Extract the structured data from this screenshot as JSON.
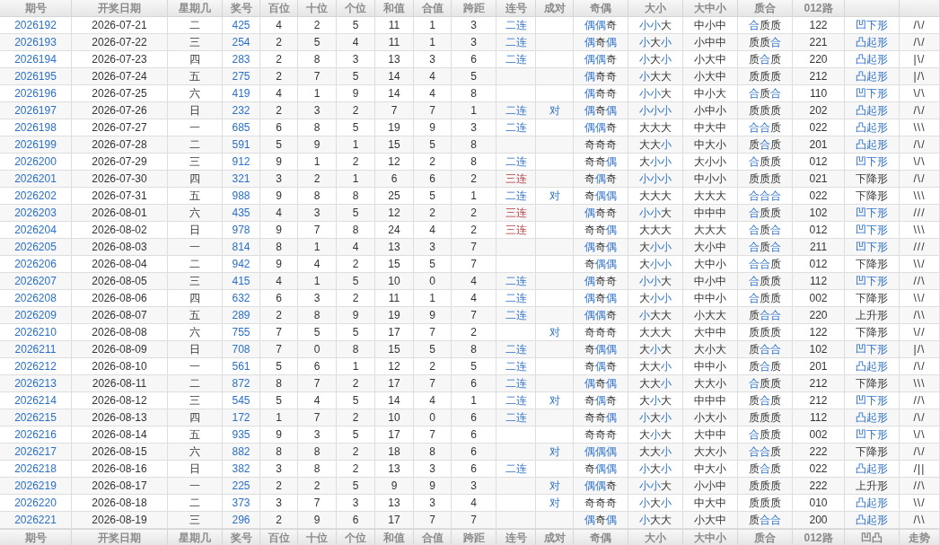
{
  "header_top": [
    "期号",
    "开奖日期",
    "星期几",
    "奖号",
    "百位",
    "十位",
    "个位",
    "和值",
    "合值",
    "跨距",
    "连号",
    "成对",
    "奇偶",
    "大小",
    "大中小",
    "质合",
    "012路"
  ],
  "rows": [
    {
      "issue": "2026192",
      "date": "2026-07-21",
      "weekday": "二",
      "number": "425",
      "hundreds": "4",
      "tens": "2",
      "units": "5",
      "sum": "11",
      "sum_tail": "1",
      "span": "3",
      "consecutive": {
        "text": "二连",
        "kind": "double"
      },
      "parity": {
        "text": "偶偶奇",
        "marked": [
          true,
          true,
          false
        ]
      },
      "size": {
        "text": "小小大",
        "marked": [
          true,
          true,
          false
        ]
      },
      "range": "中小中",
      "prime": {
        "text": "合质质",
        "marked": [
          true,
          false,
          false
        ]
      },
      "road": "122",
      "shape": {
        "text": "凹下形",
        "marked": true
      },
      "trend": "/\\/"
    },
    {
      "issue": "2026193",
      "date": "2026-07-22",
      "weekday": "三",
      "number": "254",
      "hundreds": "2",
      "tens": "5",
      "units": "4",
      "sum": "11",
      "sum_tail": "1",
      "span": "3",
      "consecutive": {
        "text": "二连",
        "kind": "double"
      },
      "parity": {
        "text": "偶奇偶",
        "marked": [
          true,
          false,
          true
        ]
      },
      "size": {
        "text": "小大小",
        "marked": [
          true,
          false,
          true
        ]
      },
      "range": "小中中",
      "prime": {
        "text": "质质合",
        "marked": [
          false,
          false,
          true
        ]
      },
      "road": "221",
      "shape": {
        "text": "凸起形",
        "marked": true
      },
      "trend": "/\\/"
    },
    {
      "issue": "2026194",
      "date": "2026-07-23",
      "weekday": "四",
      "number": "283",
      "hundreds": "2",
      "tens": "8",
      "units": "3",
      "sum": "13",
      "sum_tail": "3",
      "span": "6",
      "consecutive": {
        "text": "二连",
        "kind": "double"
      },
      "parity": {
        "text": "偶偶奇",
        "marked": [
          true,
          true,
          false
        ]
      },
      "size": {
        "text": "小大小",
        "marked": [
          true,
          false,
          true
        ]
      },
      "range": "小大中",
      "prime": {
        "text": "质合质",
        "marked": [
          false,
          true,
          false
        ]
      },
      "road": "220",
      "shape": {
        "text": "凸起形",
        "marked": true
      },
      "trend": "|\\/"
    },
    {
      "issue": "2026195",
      "date": "2026-07-24",
      "weekday": "五",
      "number": "275",
      "hundreds": "2",
      "tens": "7",
      "units": "5",
      "sum": "14",
      "sum_tail": "4",
      "span": "5",
      "parity": {
        "text": "偶奇奇",
        "marked": [
          true,
          false,
          false
        ]
      },
      "size": {
        "text": "小大大",
        "marked": [
          true,
          false,
          false
        ]
      },
      "range": "小大中",
      "prime": {
        "text": "质质质",
        "marked": [
          false,
          false,
          false
        ]
      },
      "road": "212",
      "shape": {
        "text": "凸起形",
        "marked": true
      },
      "trend": "|/\\"
    },
    {
      "issue": "2026196",
      "date": "2026-07-25",
      "weekday": "六",
      "number": "419",
      "hundreds": "4",
      "tens": "1",
      "units": "9",
      "sum": "14",
      "sum_tail": "4",
      "span": "8",
      "parity": {
        "text": "偶奇奇",
        "marked": [
          true,
          false,
          false
        ]
      },
      "size": {
        "text": "小小大",
        "marked": [
          true,
          true,
          false
        ]
      },
      "range": "中小大",
      "prime": {
        "text": "合质合",
        "marked": [
          true,
          false,
          true
        ]
      },
      "road": "110",
      "shape": {
        "text": "凹下形",
        "marked": true
      },
      "trend": "\\/\\"
    },
    {
      "issue": "2026197",
      "date": "2026-07-26",
      "weekday": "日",
      "number": "232",
      "hundreds": "2",
      "tens": "3",
      "units": "2",
      "sum": "7",
      "sum_tail": "7",
      "span": "1",
      "consecutive": {
        "text": "二连",
        "kind": "double"
      },
      "pair": "对",
      "parity": {
        "text": "偶奇偶",
        "marked": [
          true,
          false,
          true
        ]
      },
      "size": {
        "text": "小小小",
        "marked": [
          true,
          true,
          true
        ]
      },
      "range": "小中小",
      "prime": {
        "text": "质质质",
        "marked": [
          false,
          false,
          false
        ]
      },
      "road": "202",
      "shape": {
        "text": "凸起形",
        "marked": true
      },
      "trend": "/\\/"
    },
    {
      "issue": "2026198",
      "date": "2026-07-27",
      "weekday": "一",
      "number": "685",
      "hundreds": "6",
      "tens": "8",
      "units": "5",
      "sum": "19",
      "sum_tail": "9",
      "span": "3",
      "consecutive": {
        "text": "二连",
        "kind": "double"
      },
      "parity": {
        "text": "偶偶奇",
        "marked": [
          true,
          true,
          false
        ]
      },
      "size": {
        "text": "大大大",
        "marked": [
          false,
          false,
          false
        ]
      },
      "range": "中大中",
      "prime": {
        "text": "合合质",
        "marked": [
          true,
          true,
          false
        ]
      },
      "road": "022",
      "shape": {
        "text": "凸起形",
        "marked": true
      },
      "trend": "\\\\\\"
    },
    {
      "issue": "2026199",
      "date": "2026-07-28",
      "weekday": "二",
      "number": "591",
      "hundreds": "5",
      "tens": "9",
      "units": "1",
      "sum": "15",
      "sum_tail": "5",
      "span": "8",
      "parity": {
        "text": "奇奇奇",
        "marked": [
          false,
          false,
          false
        ]
      },
      "size": {
        "text": "大大小",
        "marked": [
          false,
          false,
          true
        ]
      },
      "range": "中大小",
      "prime": {
        "text": "质合质",
        "marked": [
          false,
          true,
          false
        ]
      },
      "road": "201",
      "shape": {
        "text": "凸起形",
        "marked": true
      },
      "trend": "/\\/"
    },
    {
      "issue": "2026200",
      "date": "2026-07-29",
      "weekday": "三",
      "number": "912",
      "hundreds": "9",
      "tens": "1",
      "units": "2",
      "sum": "12",
      "sum_tail": "2",
      "span": "8",
      "consecutive": {
        "text": "二连",
        "kind": "double"
      },
      "parity": {
        "text": "奇奇偶",
        "marked": [
          false,
          false,
          true
        ]
      },
      "size": {
        "text": "大小小",
        "marked": [
          false,
          true,
          true
        ]
      },
      "range": "大小小",
      "prime": {
        "text": "合质质",
        "marked": [
          true,
          false,
          false
        ]
      },
      "road": "012",
      "shape": {
        "text": "凹下形",
        "marked": true
      },
      "trend": "\\/\\"
    },
    {
      "issue": "2026201",
      "date": "2026-07-30",
      "weekday": "四",
      "number": "321",
      "hundreds": "3",
      "tens": "2",
      "units": "1",
      "sum": "6",
      "sum_tail": "6",
      "span": "2",
      "consecutive": {
        "text": "三连",
        "kind": "triple"
      },
      "parity": {
        "text": "奇偶奇",
        "marked": [
          false,
          true,
          false
        ]
      },
      "size": {
        "text": "小小小",
        "marked": [
          true,
          true,
          true
        ]
      },
      "range": "中小小",
      "prime": {
        "text": "质质质",
        "marked": [
          false,
          false,
          false
        ]
      },
      "road": "021",
      "shape": {
        "text": "下降形",
        "marked": false
      },
      "trend": "/\\/"
    },
    {
      "issue": "2026202",
      "date": "2026-07-31",
      "weekday": "五",
      "number": "988",
      "hundreds": "9",
      "tens": "8",
      "units": "8",
      "sum": "25",
      "sum_tail": "5",
      "span": "1",
      "consecutive": {
        "text": "二连",
        "kind": "double"
      },
      "pair": "对",
      "parity": {
        "text": "奇偶偶",
        "marked": [
          false,
          true,
          true
        ]
      },
      "size": {
        "text": "大大大",
        "marked": [
          false,
          false,
          false
        ]
      },
      "range": "大大大",
      "prime": {
        "text": "合合合",
        "marked": [
          true,
          true,
          true
        ]
      },
      "road": "022",
      "shape": {
        "text": "下降形",
        "marked": false
      },
      "trend": "\\\\\\"
    },
    {
      "issue": "2026203",
      "date": "2026-08-01",
      "weekday": "六",
      "number": "435",
      "hundreds": "4",
      "tens": "3",
      "units": "5",
      "sum": "12",
      "sum_tail": "2",
      "span": "2",
      "consecutive": {
        "text": "三连",
        "kind": "triple"
      },
      "parity": {
        "text": "偶奇奇",
        "marked": [
          true,
          false,
          false
        ]
      },
      "size": {
        "text": "小小大",
        "marked": [
          true,
          true,
          false
        ]
      },
      "range": "中中中",
      "prime": {
        "text": "合质质",
        "marked": [
          true,
          false,
          false
        ]
      },
      "road": "102",
      "shape": {
        "text": "凹下形",
        "marked": true
      },
      "trend": "///"
    },
    {
      "issue": "2026204",
      "date": "2026-08-02",
      "weekday": "日",
      "number": "978",
      "hundreds": "9",
      "tens": "7",
      "units": "8",
      "sum": "24",
      "sum_tail": "4",
      "span": "2",
      "consecutive": {
        "text": "三连",
        "kind": "triple"
      },
      "parity": {
        "text": "奇奇偶",
        "marked": [
          false,
          false,
          true
        ]
      },
      "size": {
        "text": "大大大",
        "marked": [
          false,
          false,
          false
        ]
      },
      "range": "大大大",
      "prime": {
        "text": "合质合",
        "marked": [
          true,
          false,
          true
        ]
      },
      "road": "012",
      "shape": {
        "text": "凹下形",
        "marked": true
      },
      "trend": "\\\\\\"
    },
    {
      "issue": "2026205",
      "date": "2026-08-03",
      "weekday": "一",
      "number": "814",
      "hundreds": "8",
      "tens": "1",
      "units": "4",
      "sum": "13",
      "sum_tail": "3",
      "span": "7",
      "parity": {
        "text": "偶奇偶",
        "marked": [
          true,
          false,
          true
        ]
      },
      "size": {
        "text": "大小小",
        "marked": [
          false,
          true,
          true
        ]
      },
      "range": "大小中",
      "prime": {
        "text": "合质合",
        "marked": [
          true,
          false,
          true
        ]
      },
      "road": "211",
      "shape": {
        "text": "凹下形",
        "marked": true
      },
      "trend": "///"
    },
    {
      "issue": "2026206",
      "date": "2026-08-04",
      "weekday": "二",
      "number": "942",
      "hundreds": "9",
      "tens": "4",
      "units": "2",
      "sum": "15",
      "sum_tail": "5",
      "span": "7",
      "parity": {
        "text": "奇偶偶",
        "marked": [
          false,
          true,
          true
        ]
      },
      "size": {
        "text": "大小小",
        "marked": [
          false,
          true,
          true
        ]
      },
      "range": "大中小",
      "prime": {
        "text": "合合质",
        "marked": [
          true,
          true,
          false
        ]
      },
      "road": "012",
      "shape": {
        "text": "下降形",
        "marked": false
      },
      "trend": "\\\\/"
    },
    {
      "issue": "2026207",
      "date": "2026-08-05",
      "weekday": "三",
      "number": "415",
      "hundreds": "4",
      "tens": "1",
      "units": "5",
      "sum": "10",
      "sum_tail": "0",
      "span": "4",
      "consecutive": {
        "text": "二连",
        "kind": "double"
      },
      "parity": {
        "text": "偶奇奇",
        "marked": [
          true,
          false,
          false
        ]
      },
      "size": {
        "text": "小小大",
        "marked": [
          true,
          true,
          false
        ]
      },
      "range": "中小中",
      "prime": {
        "text": "合质质",
        "marked": [
          true,
          false,
          false
        ]
      },
      "road": "112",
      "shape": {
        "text": "凹下形",
        "marked": true
      },
      "trend": "//\\"
    },
    {
      "issue": "2026208",
      "date": "2026-08-06",
      "weekday": "四",
      "number": "632",
      "hundreds": "6",
      "tens": "3",
      "units": "2",
      "sum": "11",
      "sum_tail": "1",
      "span": "4",
      "consecutive": {
        "text": "二连",
        "kind": "double"
      },
      "parity": {
        "text": "偶奇偶",
        "marked": [
          true,
          false,
          true
        ]
      },
      "size": {
        "text": "大小小",
        "marked": [
          false,
          true,
          true
        ]
      },
      "range": "中中小",
      "prime": {
        "text": "合质质",
        "marked": [
          true,
          false,
          false
        ]
      },
      "road": "002",
      "shape": {
        "text": "下降形",
        "marked": false
      },
      "trend": "\\\\/"
    },
    {
      "issue": "2026209",
      "date": "2026-08-07",
      "weekday": "五",
      "number": "289",
      "hundreds": "2",
      "tens": "8",
      "units": "9",
      "sum": "19",
      "sum_tail": "9",
      "span": "7",
      "consecutive": {
        "text": "二连",
        "kind": "double"
      },
      "parity": {
        "text": "偶偶奇",
        "marked": [
          true,
          true,
          false
        ]
      },
      "size": {
        "text": "小大大",
        "marked": [
          true,
          false,
          false
        ]
      },
      "range": "小大大",
      "prime": {
        "text": "质合合",
        "marked": [
          false,
          true,
          true
        ]
      },
      "road": "220",
      "shape": {
        "text": "上升形",
        "marked": false
      },
      "trend": "/\\\\"
    },
    {
      "issue": "2026210",
      "date": "2026-08-08",
      "weekday": "六",
      "number": "755",
      "hundreds": "7",
      "tens": "5",
      "units": "5",
      "sum": "17",
      "sum_tail": "7",
      "span": "2",
      "pair": "对",
      "parity": {
        "text": "奇奇奇",
        "marked": [
          false,
          false,
          false
        ]
      },
      "size": {
        "text": "大大大",
        "marked": [
          false,
          false,
          false
        ]
      },
      "range": "大中中",
      "prime": {
        "text": "质质质",
        "marked": [
          false,
          false,
          false
        ]
      },
      "road": "122",
      "shape": {
        "text": "下降形",
        "marked": false
      },
      "trend": "\\//"
    },
    {
      "issue": "2026211",
      "date": "2026-08-09",
      "weekday": "日",
      "number": "708",
      "hundreds": "7",
      "tens": "0",
      "units": "8",
      "sum": "15",
      "sum_tail": "5",
      "span": "8",
      "consecutive": {
        "text": "二连",
        "kind": "double"
      },
      "parity": {
        "text": "奇偶偶",
        "marked": [
          false,
          true,
          true
        ]
      },
      "size": {
        "text": "大小大",
        "marked": [
          false,
          true,
          false
        ]
      },
      "range": "大小大",
      "prime": {
        "text": "质合合",
        "marked": [
          false,
          true,
          true
        ]
      },
      "road": "102",
      "shape": {
        "text": "凹下形",
        "marked": true
      },
      "trend": "|/\\"
    },
    {
      "issue": "2026212",
      "date": "2026-08-10",
      "weekday": "一",
      "number": "561",
      "hundreds": "5",
      "tens": "6",
      "units": "1",
      "sum": "12",
      "sum_tail": "2",
      "span": "5",
      "consecutive": {
        "text": "二连",
        "kind": "double"
      },
      "parity": {
        "text": "奇偶奇",
        "marked": [
          false,
          true,
          false
        ]
      },
      "size": {
        "text": "大大小",
        "marked": [
          false,
          false,
          true
        ]
      },
      "range": "中中小",
      "prime": {
        "text": "质合质",
        "marked": [
          false,
          true,
          false
        ]
      },
      "road": "201",
      "shape": {
        "text": "凸起形",
        "marked": true
      },
      "trend": "/\\/"
    },
    {
      "issue": "2026213",
      "date": "2026-08-11",
      "weekday": "二",
      "number": "872",
      "hundreds": "8",
      "tens": "7",
      "units": "2",
      "sum": "17",
      "sum_tail": "7",
      "span": "6",
      "consecutive": {
        "text": "二连",
        "kind": "double"
      },
      "parity": {
        "text": "偶奇偶",
        "marked": [
          true,
          false,
          true
        ]
      },
      "size": {
        "text": "大大小",
        "marked": [
          false,
          false,
          true
        ]
      },
      "range": "大大小",
      "prime": {
        "text": "合质质",
        "marked": [
          true,
          false,
          false
        ]
      },
      "road": "212",
      "shape": {
        "text": "下降形",
        "marked": false
      },
      "trend": "\\\\\\"
    },
    {
      "issue": "2026214",
      "date": "2026-08-12",
      "weekday": "三",
      "number": "545",
      "hundreds": "5",
      "tens": "4",
      "units": "5",
      "sum": "14",
      "sum_tail": "4",
      "span": "1",
      "consecutive": {
        "text": "二连",
        "kind": "double"
      },
      "pair": "对",
      "parity": {
        "text": "奇偶奇",
        "marked": [
          false,
          true,
          false
        ]
      },
      "size": {
        "text": "大小大",
        "marked": [
          false,
          true,
          false
        ]
      },
      "range": "中中中",
      "prime": {
        "text": "质合质",
        "marked": [
          false,
          true,
          false
        ]
      },
      "road": "212",
      "shape": {
        "text": "凹下形",
        "marked": true
      },
      "trend": "//\\"
    },
    {
      "issue": "2026215",
      "date": "2026-08-13",
      "weekday": "四",
      "number": "172",
      "hundreds": "1",
      "tens": "7",
      "units": "2",
      "sum": "10",
      "sum_tail": "0",
      "span": "6",
      "consecutive": {
        "text": "二连",
        "kind": "double"
      },
      "parity": {
        "text": "奇奇偶",
        "marked": [
          false,
          false,
          true
        ]
      },
      "size": {
        "text": "小大小",
        "marked": [
          true,
          false,
          true
        ]
      },
      "range": "小大小",
      "prime": {
        "text": "质质质",
        "marked": [
          false,
          false,
          false
        ]
      },
      "road": "112",
      "shape": {
        "text": "凸起形",
        "marked": true
      },
      "trend": "/\\/"
    },
    {
      "issue": "2026216",
      "date": "2026-08-14",
      "weekday": "五",
      "number": "935",
      "hundreds": "9",
      "tens": "3",
      "units": "5",
      "sum": "17",
      "sum_tail": "7",
      "span": "6",
      "parity": {
        "text": "奇奇奇",
        "marked": [
          false,
          false,
          false
        ]
      },
      "size": {
        "text": "大小大",
        "marked": [
          false,
          true,
          false
        ]
      },
      "range": "大中中",
      "prime": {
        "text": "合质质",
        "marked": [
          true,
          false,
          false
        ]
      },
      "road": "002",
      "shape": {
        "text": "凹下形",
        "marked": true
      },
      "trend": "\\/\\"
    },
    {
      "issue": "2026217",
      "date": "2026-08-15",
      "weekday": "六",
      "number": "882",
      "hundreds": "8",
      "tens": "8",
      "units": "2",
      "sum": "18",
      "sum_tail": "8",
      "span": "6",
      "pair": "对",
      "parity": {
        "text": "偶偶偶",
        "marked": [
          true,
          true,
          true
        ]
      },
      "size": {
        "text": "大大小",
        "marked": [
          false,
          false,
          true
        ]
      },
      "range": "大大小",
      "prime": {
        "text": "合合质",
        "marked": [
          true,
          true,
          false
        ]
      },
      "road": "222",
      "shape": {
        "text": "下降形",
        "marked": false
      },
      "trend": "/\\/"
    },
    {
      "issue": "2026218",
      "date": "2026-08-16",
      "weekday": "日",
      "number": "382",
      "hundreds": "3",
      "tens": "8",
      "units": "2",
      "sum": "13",
      "sum_tail": "3",
      "span": "6",
      "consecutive": {
        "text": "二连",
        "kind": "double"
      },
      "parity": {
        "text": "奇偶偶",
        "marked": [
          false,
          true,
          true
        ]
      },
      "size": {
        "text": "小大小",
        "marked": [
          true,
          false,
          true
        ]
      },
      "range": "中大小",
      "prime": {
        "text": "质合质",
        "marked": [
          false,
          true,
          false
        ]
      },
      "road": "022",
      "shape": {
        "text": "凸起形",
        "marked": true
      },
      "trend": "/||"
    },
    {
      "issue": "2026219",
      "date": "2026-08-17",
      "weekday": "一",
      "number": "225",
      "hundreds": "2",
      "tens": "2",
      "units": "5",
      "sum": "9",
      "sum_tail": "9",
      "span": "3",
      "pair": "对",
      "parity": {
        "text": "偶偶奇",
        "marked": [
          true,
          true,
          false
        ]
      },
      "size": {
        "text": "小小大",
        "marked": [
          true,
          true,
          false
        ]
      },
      "range": "小小中",
      "prime": {
        "text": "质质质",
        "marked": [
          false,
          false,
          false
        ]
      },
      "road": "222",
      "shape": {
        "text": "上升形",
        "marked": false
      },
      "trend": "//\\"
    },
    {
      "issue": "2026220",
      "date": "2026-08-18",
      "weekday": "二",
      "number": "373",
      "hundreds": "3",
      "tens": "7",
      "units": "3",
      "sum": "13",
      "sum_tail": "3",
      "span": "4",
      "pair": "对",
      "parity": {
        "text": "奇奇奇",
        "marked": [
          false,
          false,
          false
        ]
      },
      "size": {
        "text": "小大小",
        "marked": [
          true,
          false,
          true
        ]
      },
      "range": "中大中",
      "prime": {
        "text": "质质质",
        "marked": [
          false,
          false,
          false
        ]
      },
      "road": "010",
      "shape": {
        "text": "凸起形",
        "marked": true
      },
      "trend": "\\\\/"
    },
    {
      "issue": "2026221",
      "date": "2026-08-19",
      "weekday": "三",
      "number": "296",
      "hundreds": "2",
      "tens": "9",
      "units": "6",
      "sum": "17",
      "sum_tail": "7",
      "span": "7",
      "parity": {
        "text": "偶奇偶",
        "marked": [
          true,
          false,
          true
        ]
      },
      "size": {
        "text": "小大大",
        "marked": [
          true,
          false,
          false
        ]
      },
      "range": "小大中",
      "prime": {
        "text": "质合合",
        "marked": [
          false,
          true,
          true
        ]
      },
      "road": "200",
      "shape": {
        "text": "凸起形",
        "marked": true
      },
      "trend": "/\\\\"
    }
  ],
  "header_bottom": [
    "期号",
    "开奖日期",
    "星期几",
    "奖号",
    "百位",
    "十位",
    "个位",
    "和值",
    "合值",
    "跨距",
    "连号",
    "成对",
    "奇偶",
    "大小",
    "大中小",
    "质合",
    "012路",
    "凹凸",
    "走势"
  ]
}
